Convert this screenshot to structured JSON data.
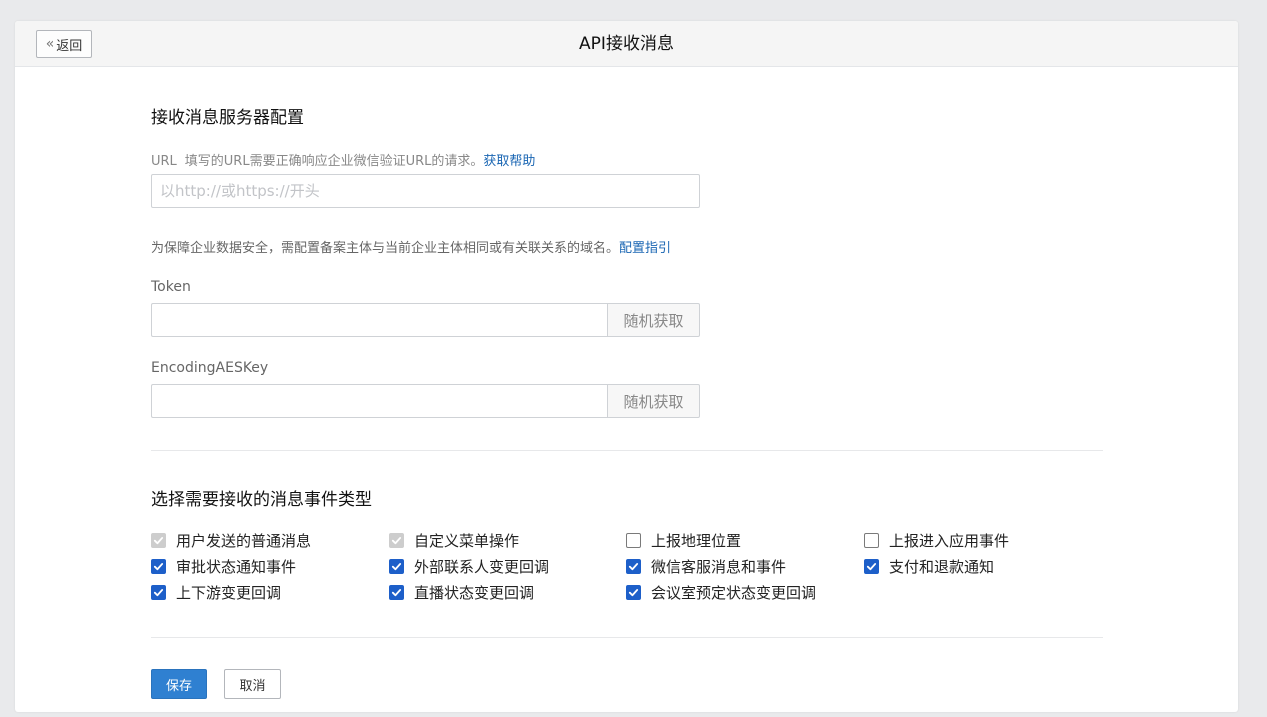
{
  "header": {
    "back_label": "返回",
    "title": "API接收消息"
  },
  "server_config": {
    "section_title": "接收消息服务器配置",
    "url_label": "URL",
    "url_hint": "填写的URL需要正确响应企业微信验证URL的请求。",
    "url_help_link": "获取帮助",
    "url_placeholder": "以http://或https://开头",
    "url_value": "",
    "url_note": "为保障企业数据安全，需配置备案主体与当前企业主体相同或有关联关系的域名。",
    "url_note_link": "配置指引",
    "token_label": "Token",
    "token_value": "",
    "aes_label": "EncodingAESKey",
    "aes_value": "",
    "random_button_label": "随机获取"
  },
  "events": {
    "section_title": "选择需要接收的消息事件类型",
    "items": [
      {
        "label": "用户发送的普通消息",
        "state": "disabled-checked"
      },
      {
        "label": "自定义菜单操作",
        "state": "disabled-checked"
      },
      {
        "label": "上报地理位置",
        "state": "unchecked"
      },
      {
        "label": "上报进入应用事件",
        "state": "unchecked"
      },
      {
        "label": "审批状态通知事件",
        "state": "checked"
      },
      {
        "label": "外部联系人变更回调",
        "state": "checked"
      },
      {
        "label": "微信客服消息和事件",
        "state": "checked"
      },
      {
        "label": "支付和退款通知",
        "state": "checked"
      },
      {
        "label": "上下游变更回调",
        "state": "checked"
      },
      {
        "label": "直播状态变更回调",
        "state": "checked"
      },
      {
        "label": "会议室预定状态变更回调",
        "state": "checked"
      }
    ]
  },
  "actions": {
    "save_label": "保存",
    "cancel_label": "取消"
  },
  "colors": {
    "accent": "#2f80d1",
    "link": "#1a66b3",
    "checkbox_checked": "#1d5fc9",
    "checkbox_disabled": "#cdcdcd"
  }
}
